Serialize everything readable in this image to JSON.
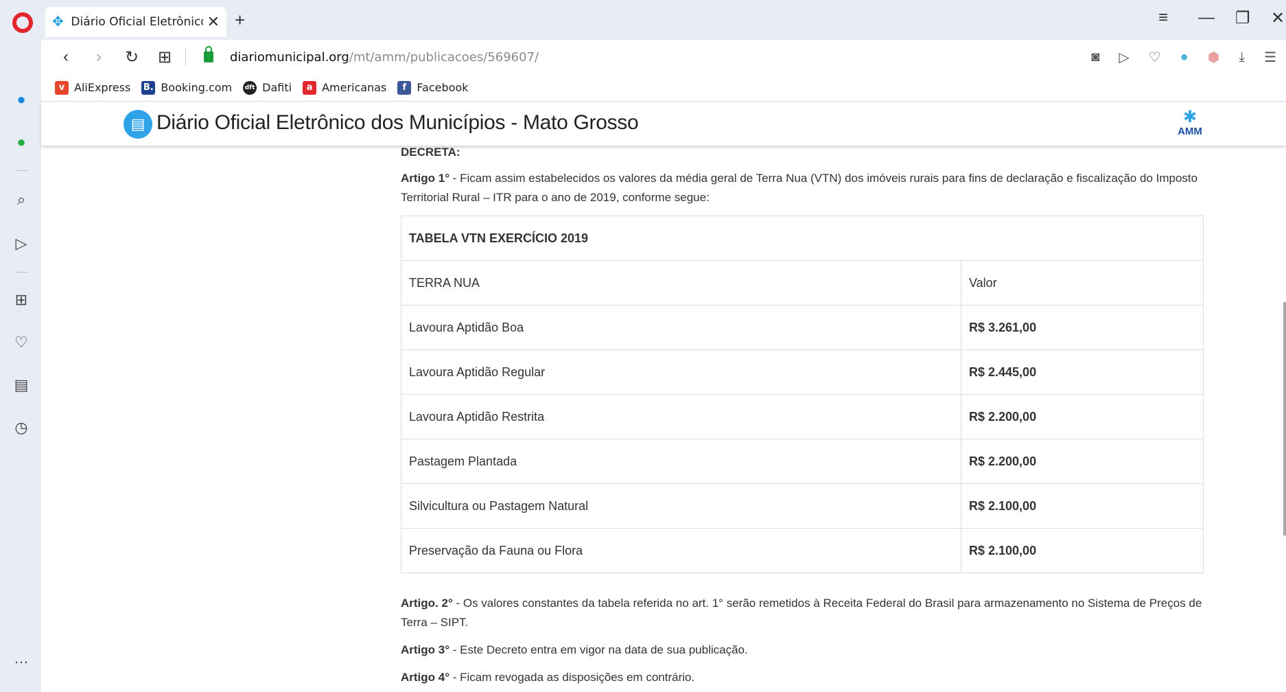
{
  "browser": {
    "tab_title": "Diário Oficial Eletrônico do",
    "url_host": "diariomunicipal.org",
    "url_path": "/mt/amm/publicacoes/569607/",
    "bookmarks": [
      {
        "label": "AliExpress",
        "color": "#e8462a",
        "icon": "v"
      },
      {
        "label": "Booking.com",
        "color": "#1f3f8f",
        "icon": "B."
      },
      {
        "label": "Dafiti",
        "color": "#222222",
        "icon": "dft"
      },
      {
        "label": "Americanas",
        "color": "#e2272e",
        "icon": "a"
      },
      {
        "label": "Facebook",
        "color": "#3b5998",
        "icon": "f"
      }
    ]
  },
  "site": {
    "title": "Diário Oficial Eletrônico dos Municípios - Mato Grosso",
    "brand": "AMM"
  },
  "document": {
    "decreta": "DECRETA:",
    "artigo1_label": "Artigo 1°",
    "artigo1_text": " - Ficam assim estabelecidos os valores da média geral de Terra Nua (VTN) dos imóveis rurais para fins de declaração e fiscalização do Imposto Territorial Rural – ITR para o ano de 2019, conforme segue:",
    "table_title": "TABELA VTN EXERCÍCIO 2019",
    "col_terra": "TERRA NUA",
    "col_valor": "Valor",
    "rows": [
      {
        "terra": "Lavoura Aptidão Boa",
        "valor": "R$ 3.261,00"
      },
      {
        "terra": "Lavoura Aptidão Regular",
        "valor": "R$ 2.445,00"
      },
      {
        "terra": "Lavoura Aptidão Restrita",
        "valor": "R$ 2.200,00"
      },
      {
        "terra": "Pastagem Plantada",
        "valor": "R$ 2.200,00"
      },
      {
        "terra": "Silvicultura ou Pastagem Natural",
        "valor": "R$ 2.100,00"
      },
      {
        "terra": "Preservação da Fauna ou Flora",
        "valor": "R$ 2.100,00"
      }
    ],
    "artigo2_label": "Artigo. 2°",
    "artigo2_text": " - Os valores constantes da tabela referida no art. 1° serão remetidos à Receita Federal do Brasil para armazenamento no Sistema de Preços de Terra – SIPT.",
    "artigo3_label": "Artigo 3°",
    "artigo3_text": " - Este Decreto entra em vigor na data de sua publicação.",
    "artigo4_label": "Artigo 4°",
    "artigo4_text": " - Ficam revogada as disposições em contrário."
  }
}
